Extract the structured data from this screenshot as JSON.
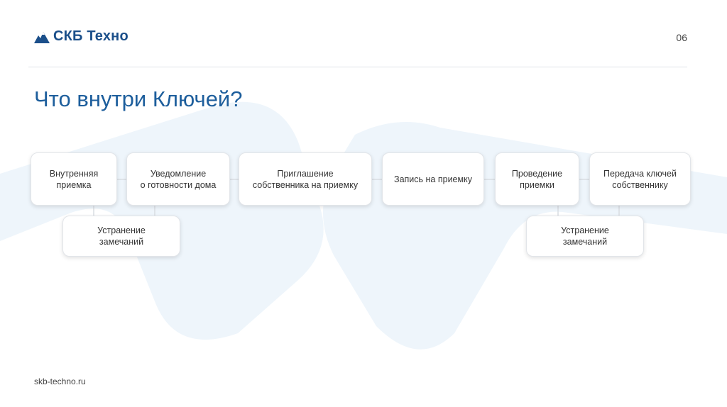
{
  "header": {
    "logo": "СКБ Техно",
    "page_number": "06"
  },
  "title": "Что внутри Ключей?",
  "diagram": {
    "steps": [
      "Внутренняя\nприемка",
      "Уведомление\nо готовности дома",
      "Приглашение\nсобственника на приемку",
      "Запись на приемку",
      "Проведение\nприемки",
      "Передача ключей\nсобственнику"
    ],
    "side_steps": [
      "Устранение\nзамечаний",
      "Устранение\nзамечаний"
    ]
  },
  "footer": {
    "url": "skb-techno.ru"
  },
  "colors": {
    "title": "#1d5e9c",
    "logo": "#1b4f8a",
    "background_shape": "#eef5fb"
  }
}
